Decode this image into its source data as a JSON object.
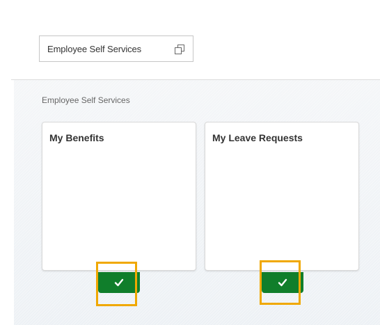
{
  "header": {
    "group_chip_label": "Employee Self Services",
    "group_chip_icon": "open-in-window-icon"
  },
  "section": {
    "title": "Employee Self Services",
    "tiles": [
      {
        "title": "My Benefits",
        "status_icon": "check-icon"
      },
      {
        "title": "My Leave Requests",
        "status_icon": "check-icon"
      }
    ]
  },
  "colors": {
    "badge": "#107e2b",
    "highlight": "#f0a800",
    "tile_border": "#d9d9d9",
    "background": "#edf1f5"
  }
}
